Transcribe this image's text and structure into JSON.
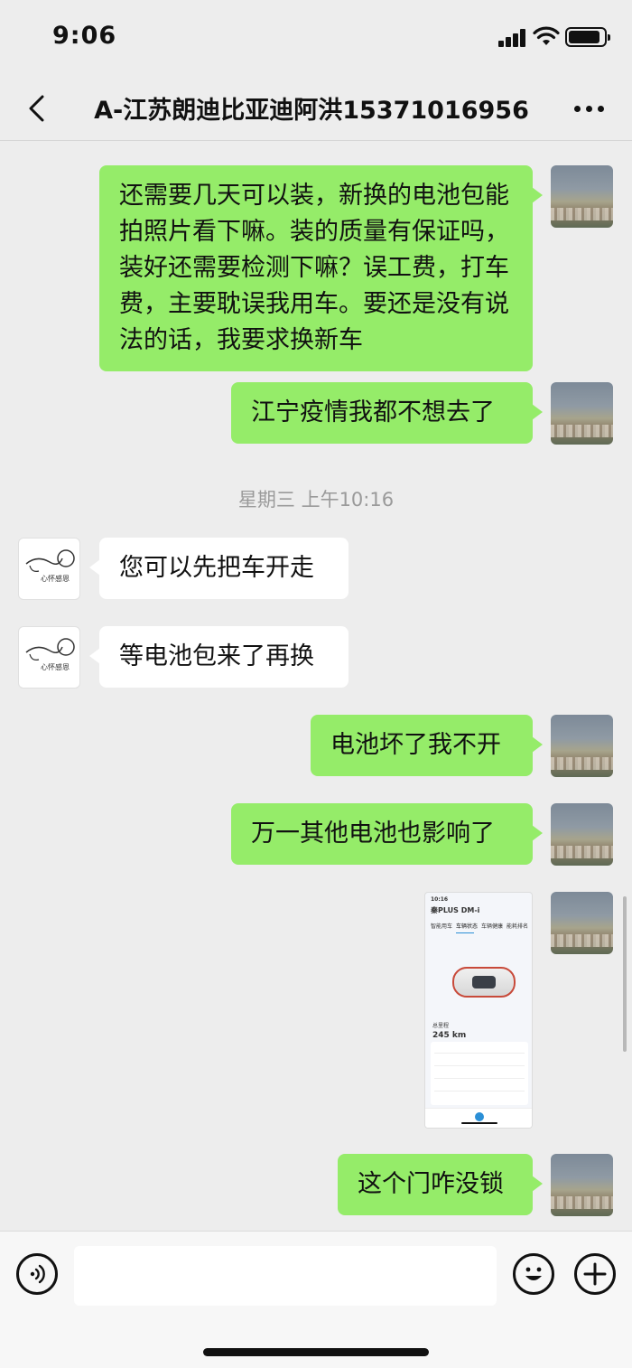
{
  "status_bar": {
    "time": "9:06",
    "battery_level": 0.8
  },
  "header": {
    "title": "A-江苏朗迪比亚迪阿洪15371016956",
    "back_icon": "chevron-left-icon",
    "more_icon": "more-dots-icon"
  },
  "messages": [
    {
      "side": "out",
      "text": "还需要几天可以装，新换的电池包能拍照片看下嘛。装的质量有保证吗，装好还需要检测下嘛？误工费，打车费，主要耽误我用车。要还是没有说法的话，我要求换新车"
    },
    {
      "side": "out",
      "text": "江宁疫情我都不想去了"
    },
    {
      "side": "in",
      "text": "您可以先把车开走"
    },
    {
      "side": "in",
      "text": "等电池包来了再换"
    },
    {
      "side": "out",
      "text": "电池坏了我不开"
    },
    {
      "side": "out",
      "text": "万一其他电池也影响了"
    },
    {
      "side": "out",
      "text": "这个门咋没锁"
    }
  ],
  "timestamp": "星期三 上午10:16",
  "other_avatar_text": "心怀感恩",
  "screenshot_message": {
    "time": "10:16",
    "car_name": "秦PLUS DM-i",
    "tabs": [
      "智能用车",
      "车辆状态",
      "车辆健康",
      "能耗排名"
    ],
    "range_label": "总里程",
    "range_value": "245 km"
  },
  "input_bar": {
    "placeholder": "",
    "voice_icon": "voice-icon",
    "emoji_icon": "emoji-icon",
    "plus_icon": "plus-icon"
  },
  "colors": {
    "outgoing_bubble": "#95ec69",
    "incoming_bubble": "#ffffff",
    "background": "#ededed"
  }
}
